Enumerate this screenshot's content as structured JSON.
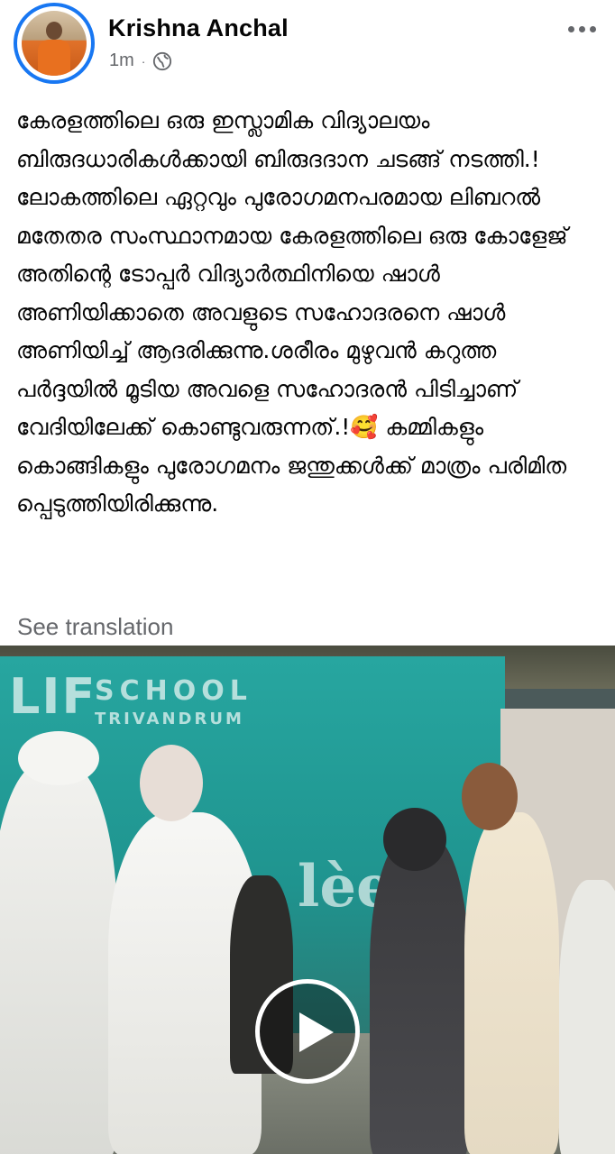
{
  "post": {
    "author_name": "Krishna Anchal",
    "timestamp": "1m",
    "separator": "·",
    "privacy_icon": "globe-icon",
    "more_icon": "more-horizontal-icon",
    "text": "കേരളത്തിലെ ഒരു ഇസ്ലാമിക വിദ്യാലയം ബിരുദധാരികൾക്കായി ബിരുദദാന ചടങ്ങ് നടത്തി.!\nലോകത്തിലെ ഏറ്റവും പുരോഗമനപരമായ ലിബറൽ മതേതര സംസ്ഥാനമായ കേരളത്തിലെ ഒരു കോളേജ് അതിന്റെ ടോപ്പർ വിദ്യാർത്ഥിനിയെ ഷാൾ അണിയിക്കാതെ അവളുടെ സഹോദരനെ ഷാൾ അണിയിച്ച് ആദരിക്കുന്നു.ശരീരം മുഴുവൻ കറുത്ത പർദ്ദയിൽ മൂടിയ അവളെ സഹോദരൻ പിടിച്ചാണ് വേദിയിലേക്ക് കൊണ്ടുവരുന്നത്.!🥰 കമ്മികളും കൊങ്ങികളും പുരോഗമനം ജന്തുക്കൾക്ക് മാത്രം പരിമിത പ്പെടുത്തിയിരിക്കുന്നു.",
    "see_translation": "See translation"
  },
  "video": {
    "sign_big": "LIF",
    "sign_school": "SCHOOL",
    "sign_city": "TRIVANDRUM",
    "logo_text": "lèef",
    "play_icon": "play-icon"
  },
  "colors": {
    "accent_ring": "#1877f2",
    "secondary_text": "#65676b",
    "primary_text": "#050505"
  }
}
